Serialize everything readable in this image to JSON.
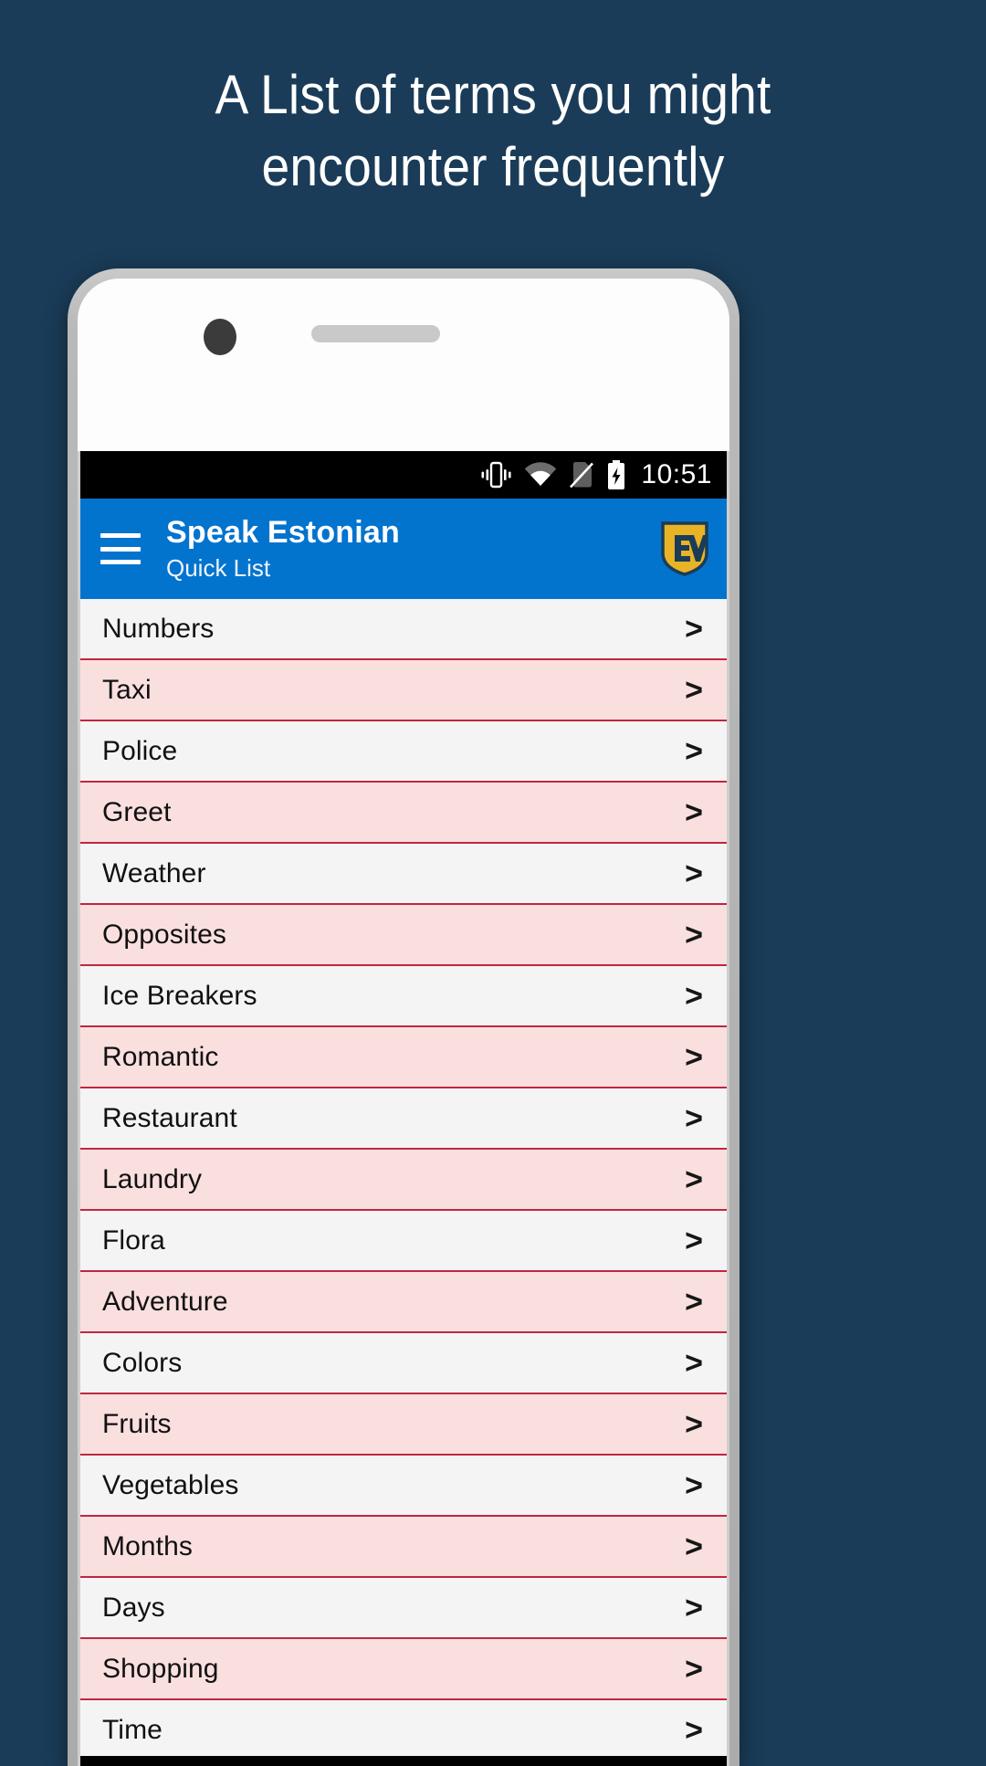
{
  "promo": {
    "headline_line1": "A List of terms you might",
    "headline_line2": "encounter frequently",
    "background_color": "#1a3c58"
  },
  "statusbar": {
    "time": "10:51",
    "icons": [
      "vibrate-icon",
      "wifi-icon",
      "no-sim-icon",
      "battery-charging-icon"
    ],
    "background_color": "#000000"
  },
  "appbar": {
    "title": "Speak Estonian",
    "subtitle": "Quick List",
    "menu_icon": "hamburger-menu-icon",
    "brand_icon": "ev-shield-logo",
    "background_color": "#0374ce"
  },
  "list": {
    "chevron": ">",
    "row_color_odd": "#f4f4f4",
    "row_color_even": "#fadfdf",
    "divider_color": "#bf2740",
    "items": [
      {
        "label": "Numbers"
      },
      {
        "label": "Taxi"
      },
      {
        "label": "Police"
      },
      {
        "label": "Greet"
      },
      {
        "label": "Weather"
      },
      {
        "label": "Opposites"
      },
      {
        "label": "Ice Breakers"
      },
      {
        "label": "Romantic"
      },
      {
        "label": "Restaurant"
      },
      {
        "label": "Laundry"
      },
      {
        "label": "Flora"
      },
      {
        "label": "Adventure"
      },
      {
        "label": "Colors"
      },
      {
        "label": "Fruits"
      },
      {
        "label": "Vegetables"
      },
      {
        "label": "Months"
      },
      {
        "label": "Days"
      },
      {
        "label": "Shopping"
      },
      {
        "label": "Time"
      }
    ]
  }
}
